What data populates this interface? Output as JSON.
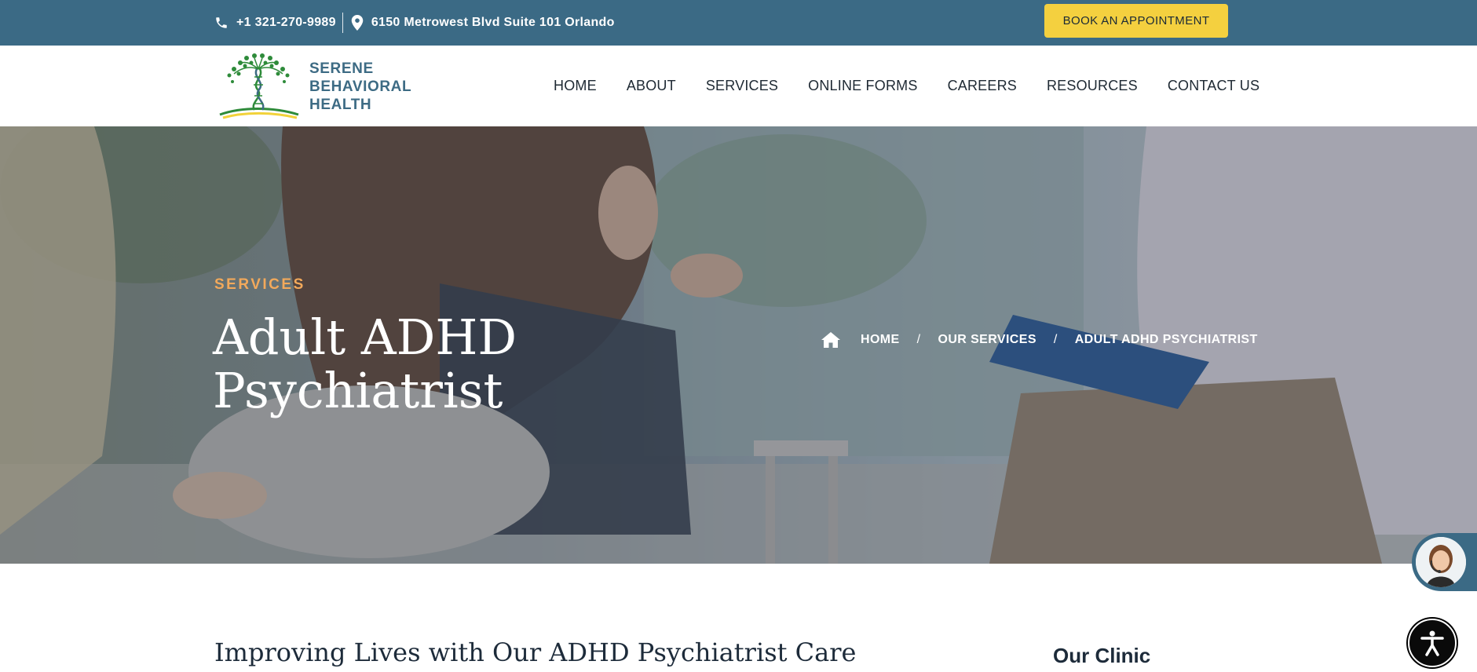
{
  "topbar": {
    "phone": "+1 321-270-9989",
    "address": "6150 Metrowest Blvd Suite 101 Orlando",
    "book_button": "BOOK AN APPOINTMENT"
  },
  "logo": {
    "line1": "SERENE",
    "line2": "BEHAVIORAL",
    "line3": "HEALTH"
  },
  "nav": {
    "items": [
      "HOME",
      "ABOUT",
      "SERVICES",
      "ONLINE FORMS",
      "CAREERS",
      "RESOURCES",
      "CONTACT US"
    ]
  },
  "hero": {
    "eyebrow": "SERVICES",
    "title_line1": "Adult ADHD",
    "title_line2": "Psychiatrist",
    "breadcrumb": {
      "home": "HOME",
      "separator": "/",
      "services": "OUR SERVICES",
      "current": "ADULT ADHD PSYCHIATRIST"
    }
  },
  "content": {
    "title": "Improving Lives with Our ADHD Psychiatrist Care",
    "sidebar_title": "Our Clinic"
  },
  "colors": {
    "topbar": "#3b6a85",
    "accent_button": "#f4d03f",
    "eyebrow": "#f2a95b",
    "logo_text": "#3d6b84"
  }
}
